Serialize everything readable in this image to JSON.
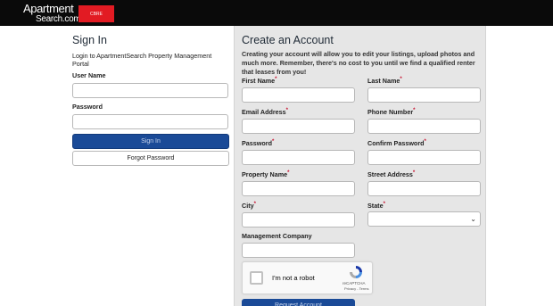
{
  "header": {
    "logo_line1": "Apartment",
    "logo_line2": "Search.com",
    "logo_badge": "CBRE"
  },
  "signin": {
    "title": "Sign In",
    "subtitle": "Login to ApartmentSearch Property Management Portal",
    "username_label": "User Name",
    "username_value": "",
    "password_label": "Password",
    "password_value": "",
    "signin_button": "Sign In",
    "forgot_button": "Forgot Password"
  },
  "create": {
    "title": "Create an Account",
    "intro": "Creating your account will allow you to edit your listings, upload photos and much more. Remember, there's no cost to you until we find a qualified renter that leases from you!",
    "required_mark": "*",
    "fields": {
      "first_name": "First Name",
      "last_name": "Last Name",
      "email": "Email Address",
      "phone": "Phone Number",
      "password": "Password",
      "confirm_password": "Confirm Password",
      "property_name": "Property Name",
      "street_address": "Street Address",
      "city": "City",
      "state": "State",
      "management_company": "Management Company"
    },
    "captcha": {
      "checkbox_label": "I'm not a robot",
      "brand": "reCAPTCHA",
      "links": "Privacy - Terms"
    },
    "submit_button": "Request Account"
  },
  "colors": {
    "topbar": "#0a0a0a",
    "brand_red": "#e21b23",
    "primary_button": "#1a4a97",
    "panel_bg": "#e6e6e6",
    "required": "#c8102e"
  }
}
